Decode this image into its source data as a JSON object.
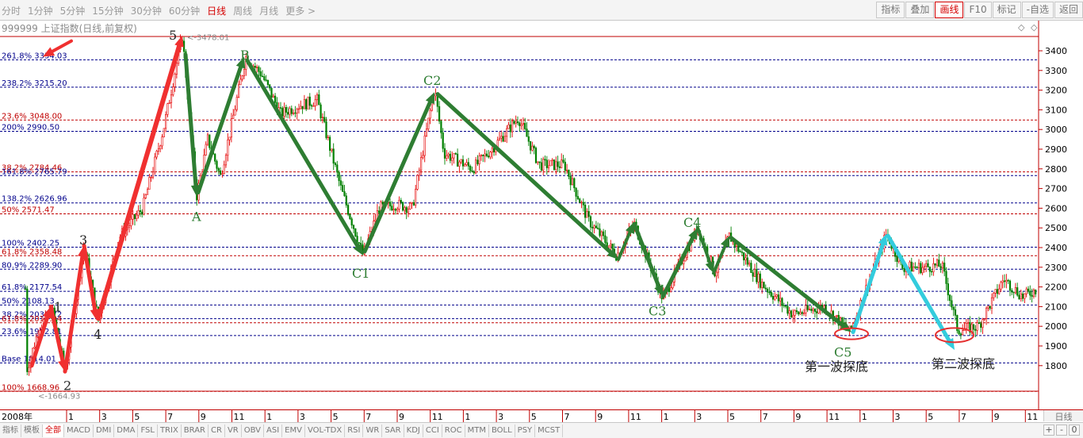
{
  "toolbar": {
    "periods": [
      {
        "label": "分时"
      },
      {
        "label": "1分钟"
      },
      {
        "label": "5分钟"
      },
      {
        "label": "15分钟"
      },
      {
        "label": "30分钟"
      },
      {
        "label": "60分钟"
      },
      {
        "label": "日线",
        "active": true
      },
      {
        "label": "周线"
      },
      {
        "label": "月线"
      },
      {
        "label": "更多 >"
      }
    ],
    "tools": [
      {
        "label": "指标"
      },
      {
        "label": "叠加"
      },
      {
        "label": "画线",
        "active": true
      },
      {
        "label": "F10"
      },
      {
        "label": "标记"
      },
      {
        "label": "-自选"
      },
      {
        "label": "返回"
      }
    ]
  },
  "chart": {
    "legend": "999999 上证指数(日线,前复权)",
    "corner_arrows": "◇ ◇",
    "high_label": "3478.01",
    "low_label": "1664.93",
    "year_label": "2008年",
    "daily_button": "日线"
  },
  "chart_data": {
    "type": "candlestick",
    "ylim": [
      1640,
      3520
    ],
    "y_ticks": [
      1800,
      1900,
      2000,
      2100,
      2200,
      2300,
      2400,
      2500,
      2600,
      2700,
      2800,
      2900,
      3000,
      3100,
      3200,
      3300,
      3400
    ],
    "x_ticks": [
      "1",
      "3",
      "5",
      "7",
      "9",
      "11",
      "1",
      "3",
      "5",
      "7",
      "9",
      "11",
      "1",
      "3",
      "5",
      "7",
      "9",
      "11",
      "1",
      "3",
      "5",
      "7",
      "9",
      "11",
      "1",
      "3",
      "5",
      "7",
      "9",
      "11"
    ],
    "fib_levels": [
      {
        "label": "261.8% 3354.03",
        "value": 3354.03,
        "color": "#00008b"
      },
      {
        "label": "238.2% 3215.20",
        "value": 3215.2,
        "color": "#00008b"
      },
      {
        "label": "23.6% 3048.00",
        "value": 3048.0,
        "color": "#c00000"
      },
      {
        "label": "200% 2990.50",
        "value": 2990.5,
        "color": "#00008b"
      },
      {
        "label": "38.2% 2784.46",
        "value": 2784.46,
        "color": "#c00000"
      },
      {
        "label": "161.8% 2765.79",
        "value": 2765.79,
        "color": "#00008b"
      },
      {
        "label": "138.2% 2626.96",
        "value": 2626.96,
        "color": "#00008b"
      },
      {
        "label": "50% 2571.47",
        "value": 2571.47,
        "color": "#c00000"
      },
      {
        "label": "100% 2402.25",
        "value": 2402.25,
        "color": "#00008b"
      },
      {
        "label": "61.8% 2358.48",
        "value": 2358.48,
        "color": "#c00000"
      },
      {
        "label": "80.9% 2289.90",
        "value": 2289.9,
        "color": "#00008b"
      },
      {
        "label": "61.8% 2177.54",
        "value": 2177.54,
        "color": "#00008b"
      },
      {
        "label": "50% 2108.13",
        "value": 2108.13,
        "color": "#00008b"
      },
      {
        "label": "38.2% 2038.72",
        "value": 2038.72,
        "color": "#00008b"
      },
      {
        "label": "61.8% 2017.94",
        "value": 2017.94,
        "color": "#c00000"
      },
      {
        "label": "23.6% 1952.81",
        "value": 1952.81,
        "color": "#00008b"
      },
      {
        "label": "Base 1814.01",
        "value": 1814.01,
        "color": "#00008b"
      },
      {
        "label": "100% 1668.96",
        "value": 1668.96,
        "color": "#c00000"
      }
    ],
    "wave_labels": [
      {
        "text": "5",
        "value": 3478.01,
        "color": "#222222"
      },
      {
        "text": "1",
        "value": 2080,
        "color": "#222222"
      },
      {
        "text": "2",
        "value": 1760,
        "color": "#222222"
      },
      {
        "text": "3",
        "value": 2420,
        "color": "#222222"
      },
      {
        "text": "4",
        "value": 2010,
        "color": "#222222"
      },
      {
        "text": "A",
        "value": 2640,
        "color": "#2e7d32"
      },
      {
        "text": "B",
        "value": 3370,
        "color": "#2e7d32"
      },
      {
        "text": "C1",
        "value": 2340,
        "color": "#2e7d32"
      },
      {
        "text": "C2",
        "value": 3210,
        "color": "#2e7d32"
      },
      {
        "text": "C3",
        "value": 2130,
        "color": "#2e7d32"
      },
      {
        "text": "C4",
        "value": 2510,
        "color": "#2e7d32"
      },
      {
        "text": "C5",
        "value": 1940,
        "color": "#2e7d32"
      }
    ],
    "notes": [
      "第一波探底",
      "第二波探底"
    ]
  },
  "indicators": [
    {
      "label": "指标"
    },
    {
      "label": "模板"
    },
    {
      "label": "全部",
      "active": true
    },
    {
      "label": "MACD"
    },
    {
      "label": "DMI"
    },
    {
      "label": "DMA"
    },
    {
      "label": "FSL"
    },
    {
      "label": "TRIX"
    },
    {
      "label": "BRAR"
    },
    {
      "label": "CR"
    },
    {
      "label": "VR"
    },
    {
      "label": "OBV"
    },
    {
      "label": "ASI"
    },
    {
      "label": "EMV"
    },
    {
      "label": "VOL-TDX"
    },
    {
      "label": "RSI"
    },
    {
      "label": "WR"
    },
    {
      "label": "SAR"
    },
    {
      "label": "KDJ"
    },
    {
      "label": "CCI"
    },
    {
      "label": "ROC"
    },
    {
      "label": "MTM"
    },
    {
      "label": "BOLL"
    },
    {
      "label": "PSY"
    },
    {
      "label": "MCST"
    }
  ],
  "zoom": {
    "plus": "+",
    "minus": "-",
    "zero": "0"
  },
  "colors": {
    "up": "#e50000",
    "down": "#008000",
    "green_arrow": "#2e7d32",
    "red_arrow": "#f03030",
    "cyan_arrow": "#33ccdd"
  }
}
